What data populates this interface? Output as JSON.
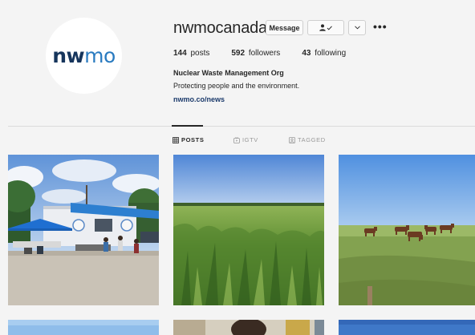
{
  "profile": {
    "username": "nwmocanada",
    "logo": {
      "part1": "nw",
      "part2": "mo"
    },
    "message_label": "Message",
    "follow_icon": "person-check-icon",
    "chevron_icon": "chevron-down-icon",
    "more_label": "•••",
    "stats": {
      "posts_count": "144",
      "posts_label": "posts",
      "followers_count": "592",
      "followers_label": "followers",
      "following_count": "43",
      "following_label": "following"
    },
    "full_name": "Nuclear Waste Management Org",
    "bio": "Protecting people and the environment.",
    "link": "nwmo.co/news"
  },
  "tabs": [
    {
      "label": "POSTS",
      "icon": "grid-icon",
      "active": true
    },
    {
      "label": "IGTV",
      "icon": "igtv-icon",
      "active": false
    },
    {
      "label": "TAGGED",
      "icon": "tagged-icon",
      "active": false
    }
  ],
  "posts": [
    {
      "subject": "outdoor-event-tents-photo"
    },
    {
      "subject": "green-corn-field-photo"
    },
    {
      "subject": "horses-grazing-field-photo"
    },
    {
      "subject": "sky-photo"
    },
    {
      "subject": "people-photo"
    },
    {
      "subject": "sky-photo"
    }
  ],
  "colors": {
    "logo_dark": "#16355c",
    "logo_light": "#2a7bc0",
    "link": "#1b3a6b",
    "background": "#f4f4f4"
  }
}
